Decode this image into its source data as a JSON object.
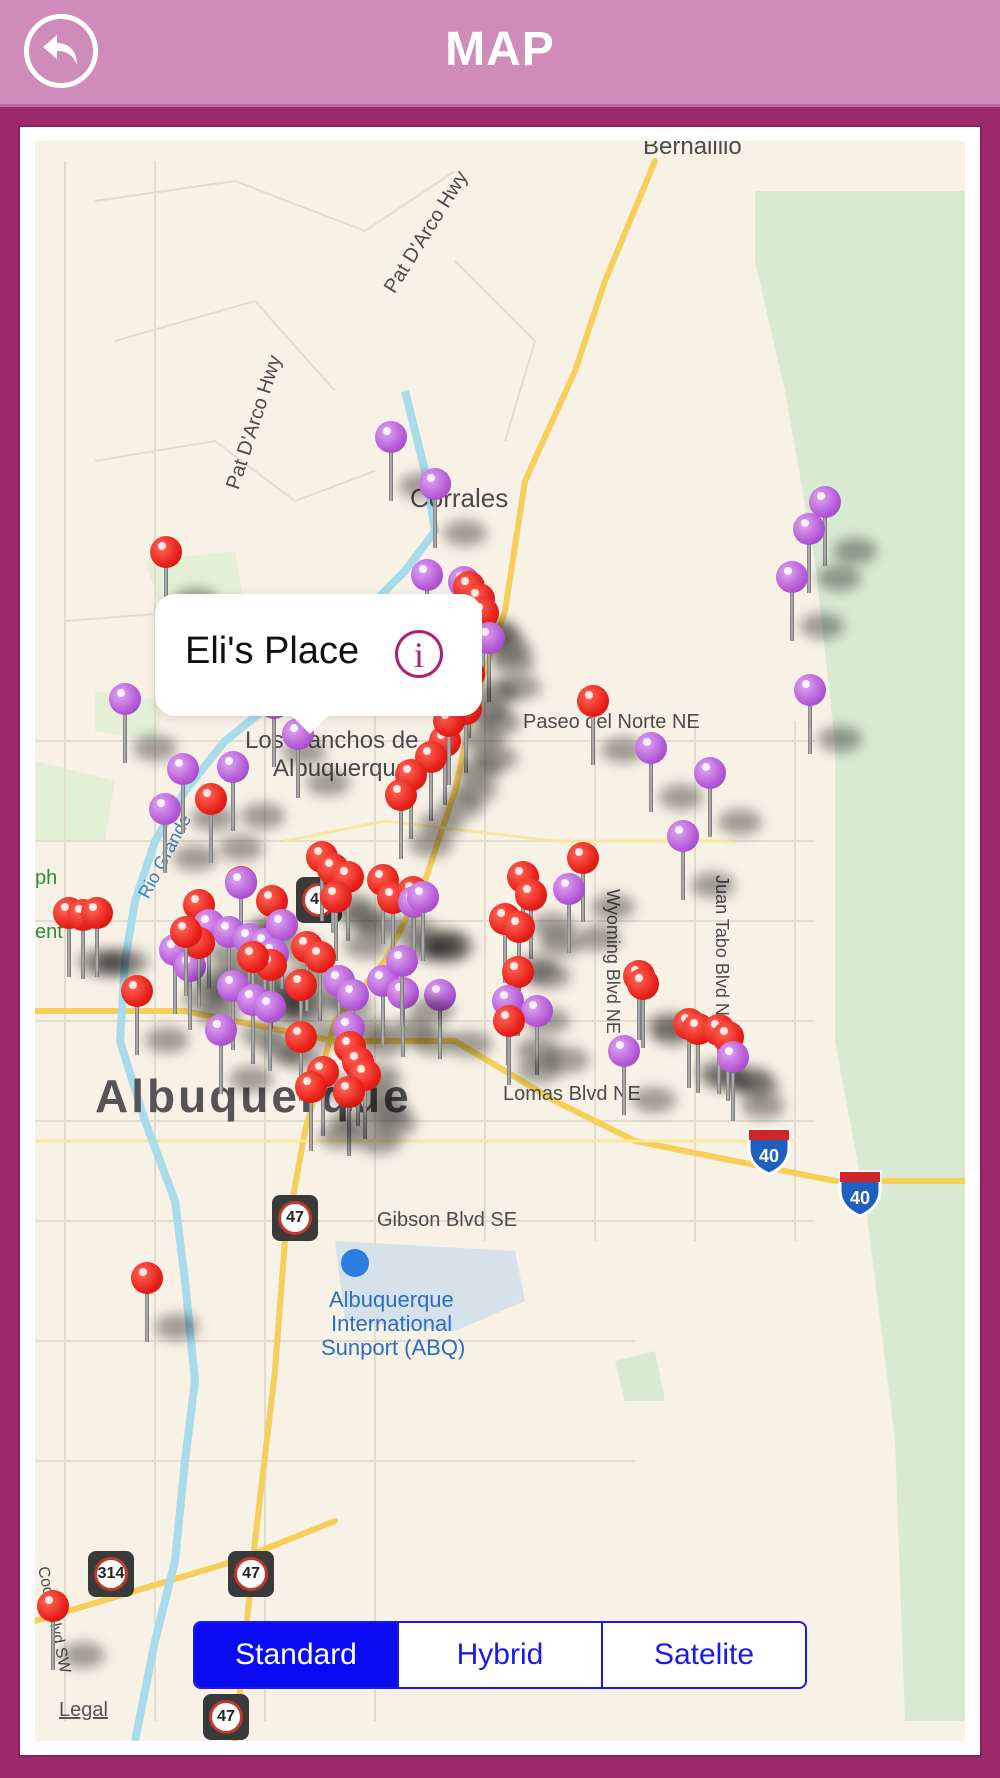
{
  "header": {
    "title": "MAP",
    "back_icon": "back-arrow-icon"
  },
  "map": {
    "labels": {
      "bernalillo": "Bernalillo",
      "pat_darco_hwy": "Pat D'Arco Hwy",
      "corrales": "Corrales",
      "los_ranchos_1": "Los Ranchos de",
      "los_ranchos_2": "Albuquerque",
      "paseo": "Paseo del Norte NE",
      "rio_grande": "Rio Grande",
      "wyoming": "Wyoming Blvd NE",
      "juan_tabo": "Juan Tabo Blvd NE",
      "albuquerque": "Albuquerque",
      "lomas": "Lomas Blvd NE",
      "gibson": "Gibson Blvd SE",
      "airport_1": "Albuquerque",
      "airport_2": "International",
      "airport_3": "Sunport (ABQ)",
      "coors": "Coors Blvd SW",
      "edge_1": "ph",
      "edge_2": "ent"
    },
    "shields": {
      "r47": "47",
      "r314": "314",
      "i40": "40"
    },
    "legal": "Legal"
  },
  "callout": {
    "title": "Eli's Place",
    "info_icon": "info-icon"
  },
  "map_type_control": {
    "options": [
      "Standard",
      "Hybrid",
      "Satelite"
    ],
    "selected": "Standard"
  },
  "colors": {
    "header_bg": "#cf8bb9",
    "frame": "#9c2a6b",
    "pin_red": "#e8211a",
    "pin_purple": "#b55ad8",
    "segment_accent": "#0a0af5"
  }
}
